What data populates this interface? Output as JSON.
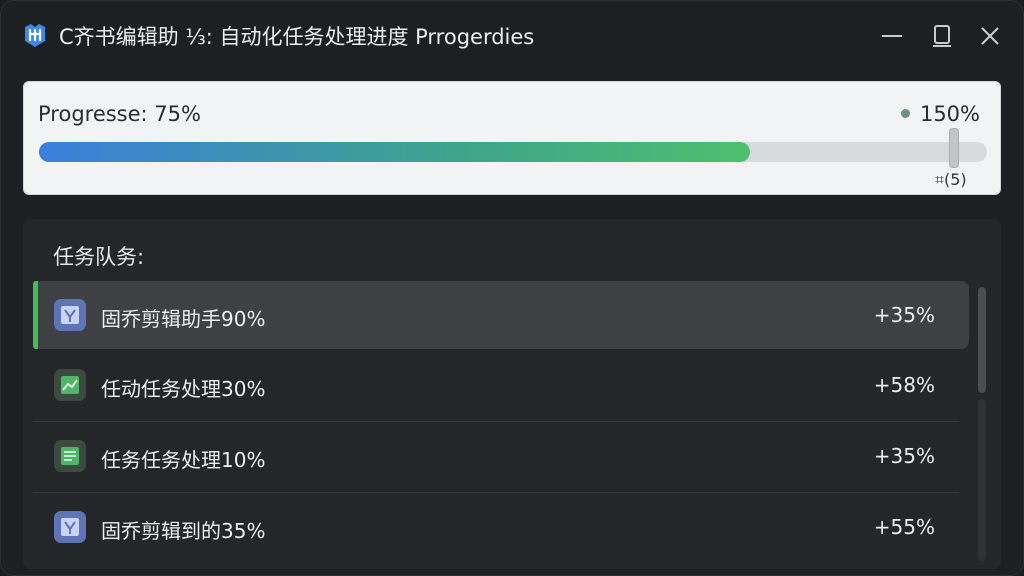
{
  "window": {
    "title": "C齐书编辑助 ⅓: 自动化任务处理进度 Prrogerdies",
    "app_icon": "app-logo-icon",
    "controls": [
      "minimize-icon",
      "maximize-icon",
      "close-icon"
    ]
  },
  "progress": {
    "label": "Progresse: 75%",
    "value": 0.75,
    "right_value": "150%",
    "slider_value": 0.965,
    "step_text": "⌗(5)",
    "colors": {
      "fill_start": "#3b7fdc",
      "fill_end": "#4dc06e",
      "dot": "#6a9478"
    }
  },
  "queue": {
    "title": "任务队务:",
    "tasks": [
      {
        "name": "固乔剪辑助手90%",
        "delta": "+35%",
        "icon": "document-scissors-icon",
        "icon_color": "#6b82c4",
        "selected": true
      },
      {
        "name": "任动任务处理30%",
        "delta": "+58%",
        "icon": "chart-icon",
        "icon_color": "#3f9a5a",
        "selected": false
      },
      {
        "name": "任务任务处理10%",
        "delta": "+35%",
        "icon": "spreadsheet-icon",
        "icon_color": "#3f9a5a",
        "selected": false
      },
      {
        "name": "固乔剪辑到的35%",
        "delta": "+55%",
        "icon": "document-scissors-icon",
        "icon_color": "#6b82c4",
        "selected": false
      }
    ]
  }
}
